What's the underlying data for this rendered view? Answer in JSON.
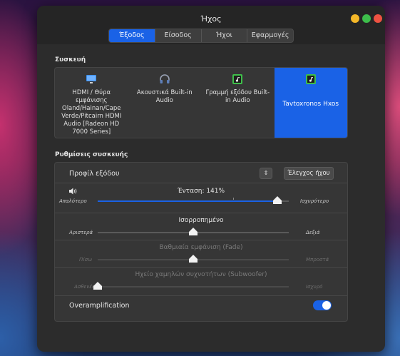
{
  "window": {
    "title": "Ήχος"
  },
  "tabs": [
    {
      "label": "Έξοδος",
      "active": true
    },
    {
      "label": "Είσοδος",
      "active": false
    },
    {
      "label": "Ήχοι",
      "active": false
    },
    {
      "label": "Εφαρμογές",
      "active": false
    }
  ],
  "device_section": {
    "title": "Συσκευή",
    "devices": [
      {
        "label": "HDMI / Θύρα εμφάνισης Oland/Hainan/Cape Verde/Pitcairn HDMI Audio [Radeon HD 7000 Series]",
        "icon": "monitor-icon",
        "selected": false
      },
      {
        "label": "Ακουστικά Built-in Audio",
        "icon": "headphones-icon",
        "selected": false
      },
      {
        "label": "Γραμμή εξόδου Built-in Audio",
        "icon": "music-note-icon",
        "selected": false
      },
      {
        "label": "Tavtoxronos Hxos",
        "icon": "music-note-icon",
        "selected": true
      }
    ]
  },
  "settings_section": {
    "title": "Ρυθμίσεις συσκευής",
    "profile": {
      "label": "Προφίλ εξόδου",
      "test_button": "Έλεγχος ήχου"
    },
    "volume": {
      "title": "Ένταση: 141%",
      "min_label": "Απαλότερο",
      "max_label": "Ισχυρότερο",
      "value_fraction": 0.94
    },
    "balance": {
      "title": "Ισορροπημένο",
      "min_label": "Αριστερά",
      "max_label": "Δεξιά",
      "value_fraction": 0.5
    },
    "fade": {
      "title": "Βαθμιαία εμφάνιση (Fade)",
      "min_label": "Πίσω",
      "max_label": "Μπροστά",
      "value_fraction": 0.5,
      "enabled": false
    },
    "subwoofer": {
      "title": "Ηχείο χαμηλών συχνοτήτων (Subwoofer)",
      "min_label": "Ασθενές",
      "max_label": "Ισχυρό",
      "value_fraction": 0.0,
      "enabled": false
    },
    "overamplification": {
      "label": "Overamplification",
      "enabled": true
    }
  },
  "colors": {
    "accent": "#1a62e6",
    "window_bg": "#2c2c2c",
    "panel_bg": "#363636"
  }
}
